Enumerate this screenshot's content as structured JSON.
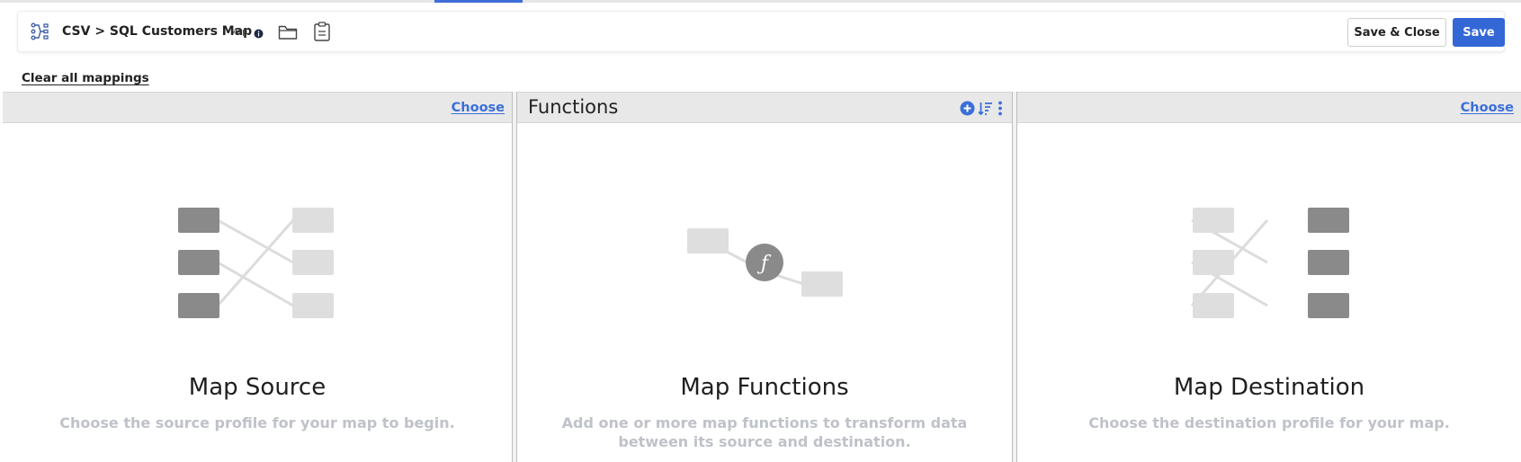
{
  "toolbar": {
    "title": "CSV > SQL Customers Map",
    "type_tag": "Map",
    "save_close_label": "Save & Close",
    "save_label": "Save"
  },
  "clear_all_label": "Clear all mappings",
  "source_panel": {
    "choose_label": "Choose",
    "heading": "Map Source",
    "description": "Choose the source profile for your map to begin."
  },
  "functions_panel": {
    "title": "Functions",
    "heading": "Map Functions",
    "description": "Add one or more map functions to transform data between its source and destination."
  },
  "destination_panel": {
    "choose_label": "Choose",
    "heading": "Map Destination",
    "description": "Choose the destination profile for your map."
  },
  "icons": {
    "map": "map-icon",
    "info": "info-icon",
    "folder": "folder-icon",
    "notes": "notes-icon",
    "add": "add-circle-icon",
    "sort": "sort-icon",
    "more": "more-vertical-icon",
    "function": "function-icon"
  },
  "colors": {
    "accent": "#3467d6",
    "link": "#3a6fd8",
    "placeholder_dark": "#8a8a8a",
    "placeholder_light": "#dedede",
    "description_text": "#bfc2c8"
  }
}
